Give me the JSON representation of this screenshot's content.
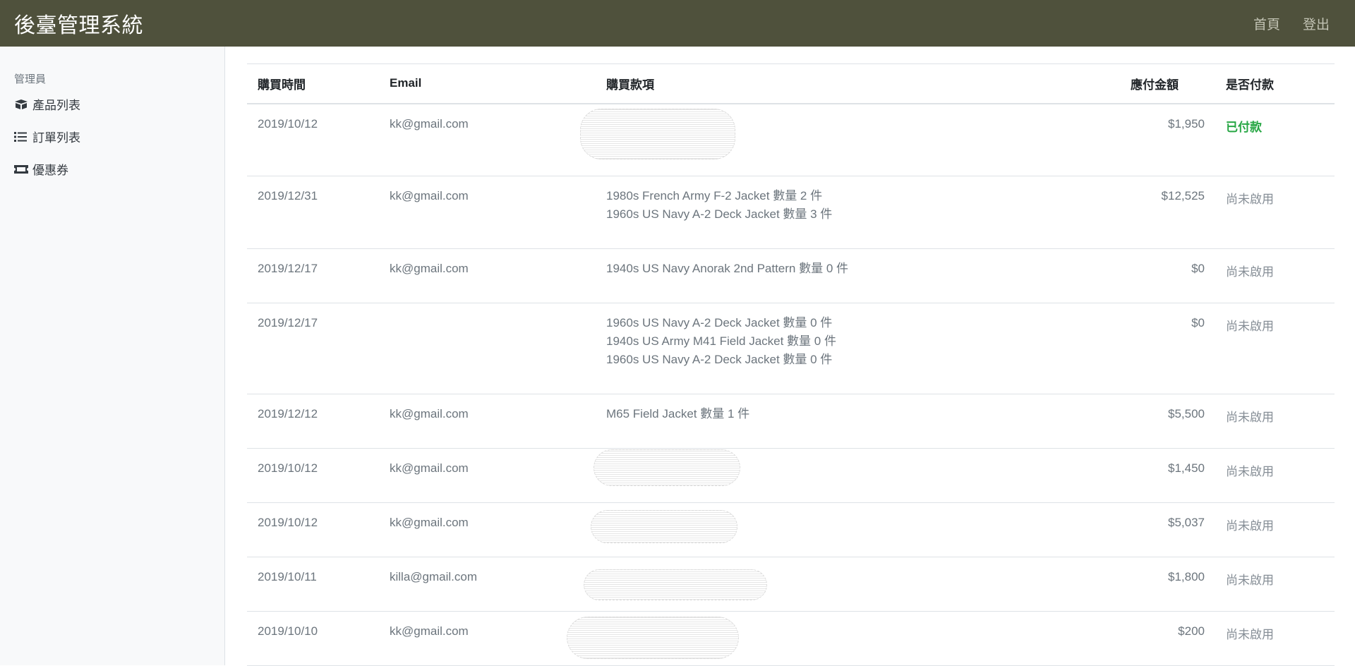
{
  "navbar": {
    "brand": "後臺管理系統",
    "links": [
      "首頁",
      "登出"
    ]
  },
  "sidebar": {
    "heading": "管理員",
    "items": [
      {
        "label": "產品列表",
        "icon": "box-icon"
      },
      {
        "label": "訂單列表",
        "icon": "list-icon"
      },
      {
        "label": "優惠券",
        "icon": "ticket-icon"
      }
    ]
  },
  "table": {
    "headers": [
      "購買時間",
      "Email",
      "購買款項",
      "應付金額",
      "是否付款"
    ],
    "rows": [
      {
        "date": "2019/10/12",
        "email": "kk@gmail.com",
        "items": [],
        "amount": "$1,950",
        "status": "已付款"
      },
      {
        "date": "2019/12/31",
        "email": "kk@gmail.com",
        "items": [
          "1980s French Army F-2 Jacket 數量 2 件",
          "1960s US Navy A-2 Deck Jacket 數量 3 件"
        ],
        "amount": "$12,525",
        "status": "尚未啟用"
      },
      {
        "date": "2019/12/17",
        "email": "kk@gmail.com",
        "items": [
          "1940s US Navy Anorak 2nd Pattern 數量 0 件"
        ],
        "amount": "$0",
        "status": "尚未啟用"
      },
      {
        "date": "2019/12/17",
        "email": "",
        "items": [
          "1960s US Navy A-2 Deck Jacket 數量 0 件",
          "1940s US Army M41 Field Jacket 數量 0 件",
          "1960s US Navy A-2 Deck Jacket 數量 0 件"
        ],
        "amount": "$0",
        "status": "尚未啟用"
      },
      {
        "date": "2019/12/12",
        "email": "kk@gmail.com",
        "items": [
          "M65 Field Jacket 數量 1 件"
        ],
        "amount": "$5,500",
        "status": "尚未啟用"
      },
      {
        "date": "2019/10/12",
        "email": "kk@gmail.com",
        "items": [],
        "amount": "$1,450",
        "status": "尚未啟用"
      },
      {
        "date": "2019/10/12",
        "email": "kk@gmail.com",
        "items": [],
        "amount": "$5,037",
        "status": "尚未啟用"
      },
      {
        "date": "2019/10/11",
        "email": "killa@gmail.com",
        "items": [],
        "amount": "$1,800",
        "status": "尚未啟用"
      },
      {
        "date": "2019/10/10",
        "email": "kk@gmail.com",
        "items": [],
        "amount": "$200",
        "status": "尚未啟用"
      }
    ]
  },
  "colors": {
    "navbar": "#4f513c",
    "paid": "#28a745",
    "unpaid": "#868e96"
  }
}
